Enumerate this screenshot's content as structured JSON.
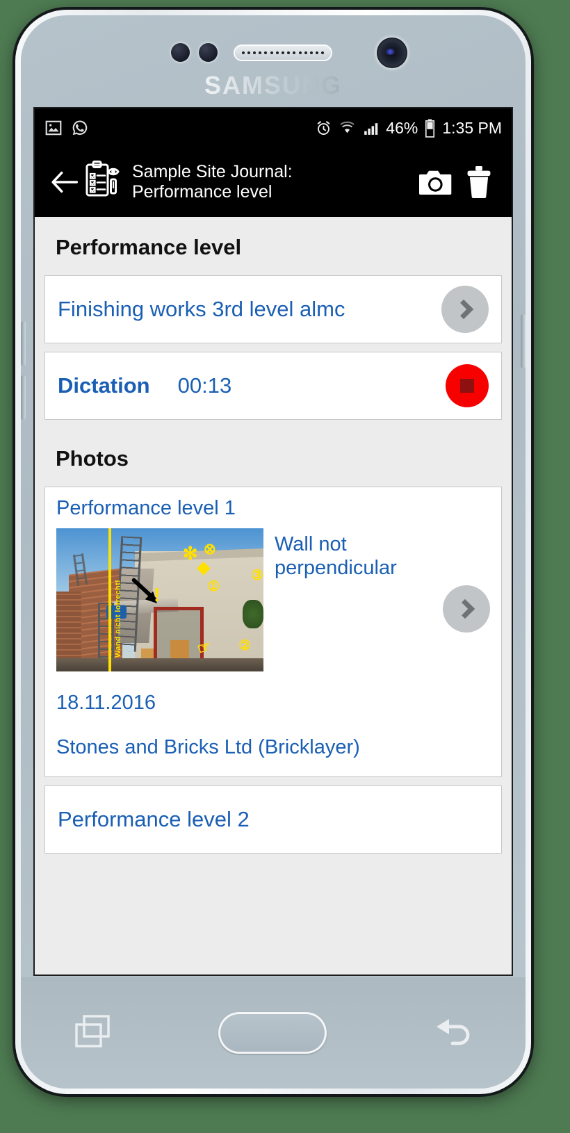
{
  "device": {
    "brand": "SAMSUNG",
    "nav": {
      "recents_label": "recents",
      "home_label": "home",
      "back_label": "back"
    }
  },
  "status_bar": {
    "left_icons": [
      "image-icon",
      "whatsapp-icon"
    ],
    "alarm_icon": "alarm-icon",
    "wifi_icon": "wifi-icon",
    "signal_icon": "signal-icon",
    "battery_percent": "46%",
    "battery_icon": "battery-icon",
    "time": "1:35 PM"
  },
  "app_bar": {
    "back_icon": "back-arrow-icon",
    "app_icon": "site-journal-icon",
    "title": "Sample Site Journal:\nPerformance level",
    "camera_icon": "camera-icon",
    "delete_icon": "trash-icon"
  },
  "main": {
    "page_title": "Performance level",
    "entry_card": {
      "text": "Finishing works 3rd level almc",
      "chevron_icon": "chevron-right-icon"
    },
    "dictation_card": {
      "label": "Dictation",
      "time": "00:13",
      "record_icon": "stop-record-icon"
    },
    "photos_title": "Photos",
    "photos": [
      {
        "title": "Performance level 1",
        "note": "Wall not perpendicular",
        "date": "18.11.2016",
        "company": "Stones and Bricks Ltd (Bricklayer)",
        "chevron_icon": "chevron-right-icon",
        "thumbnail": {
          "alt": "construction-site-photo",
          "overlay_text": "Wand nicht lotrecht!",
          "markers": [
            "✻",
            "⊗",
            "◆",
            "①",
            "③",
            "②",
            "☞",
            "!"
          ]
        }
      },
      {
        "title": "Performance level 2"
      }
    ]
  },
  "colors": {
    "link": "#1a5fb4",
    "record": "#f60000",
    "background": "#ececec",
    "app_bar": "#000000"
  }
}
